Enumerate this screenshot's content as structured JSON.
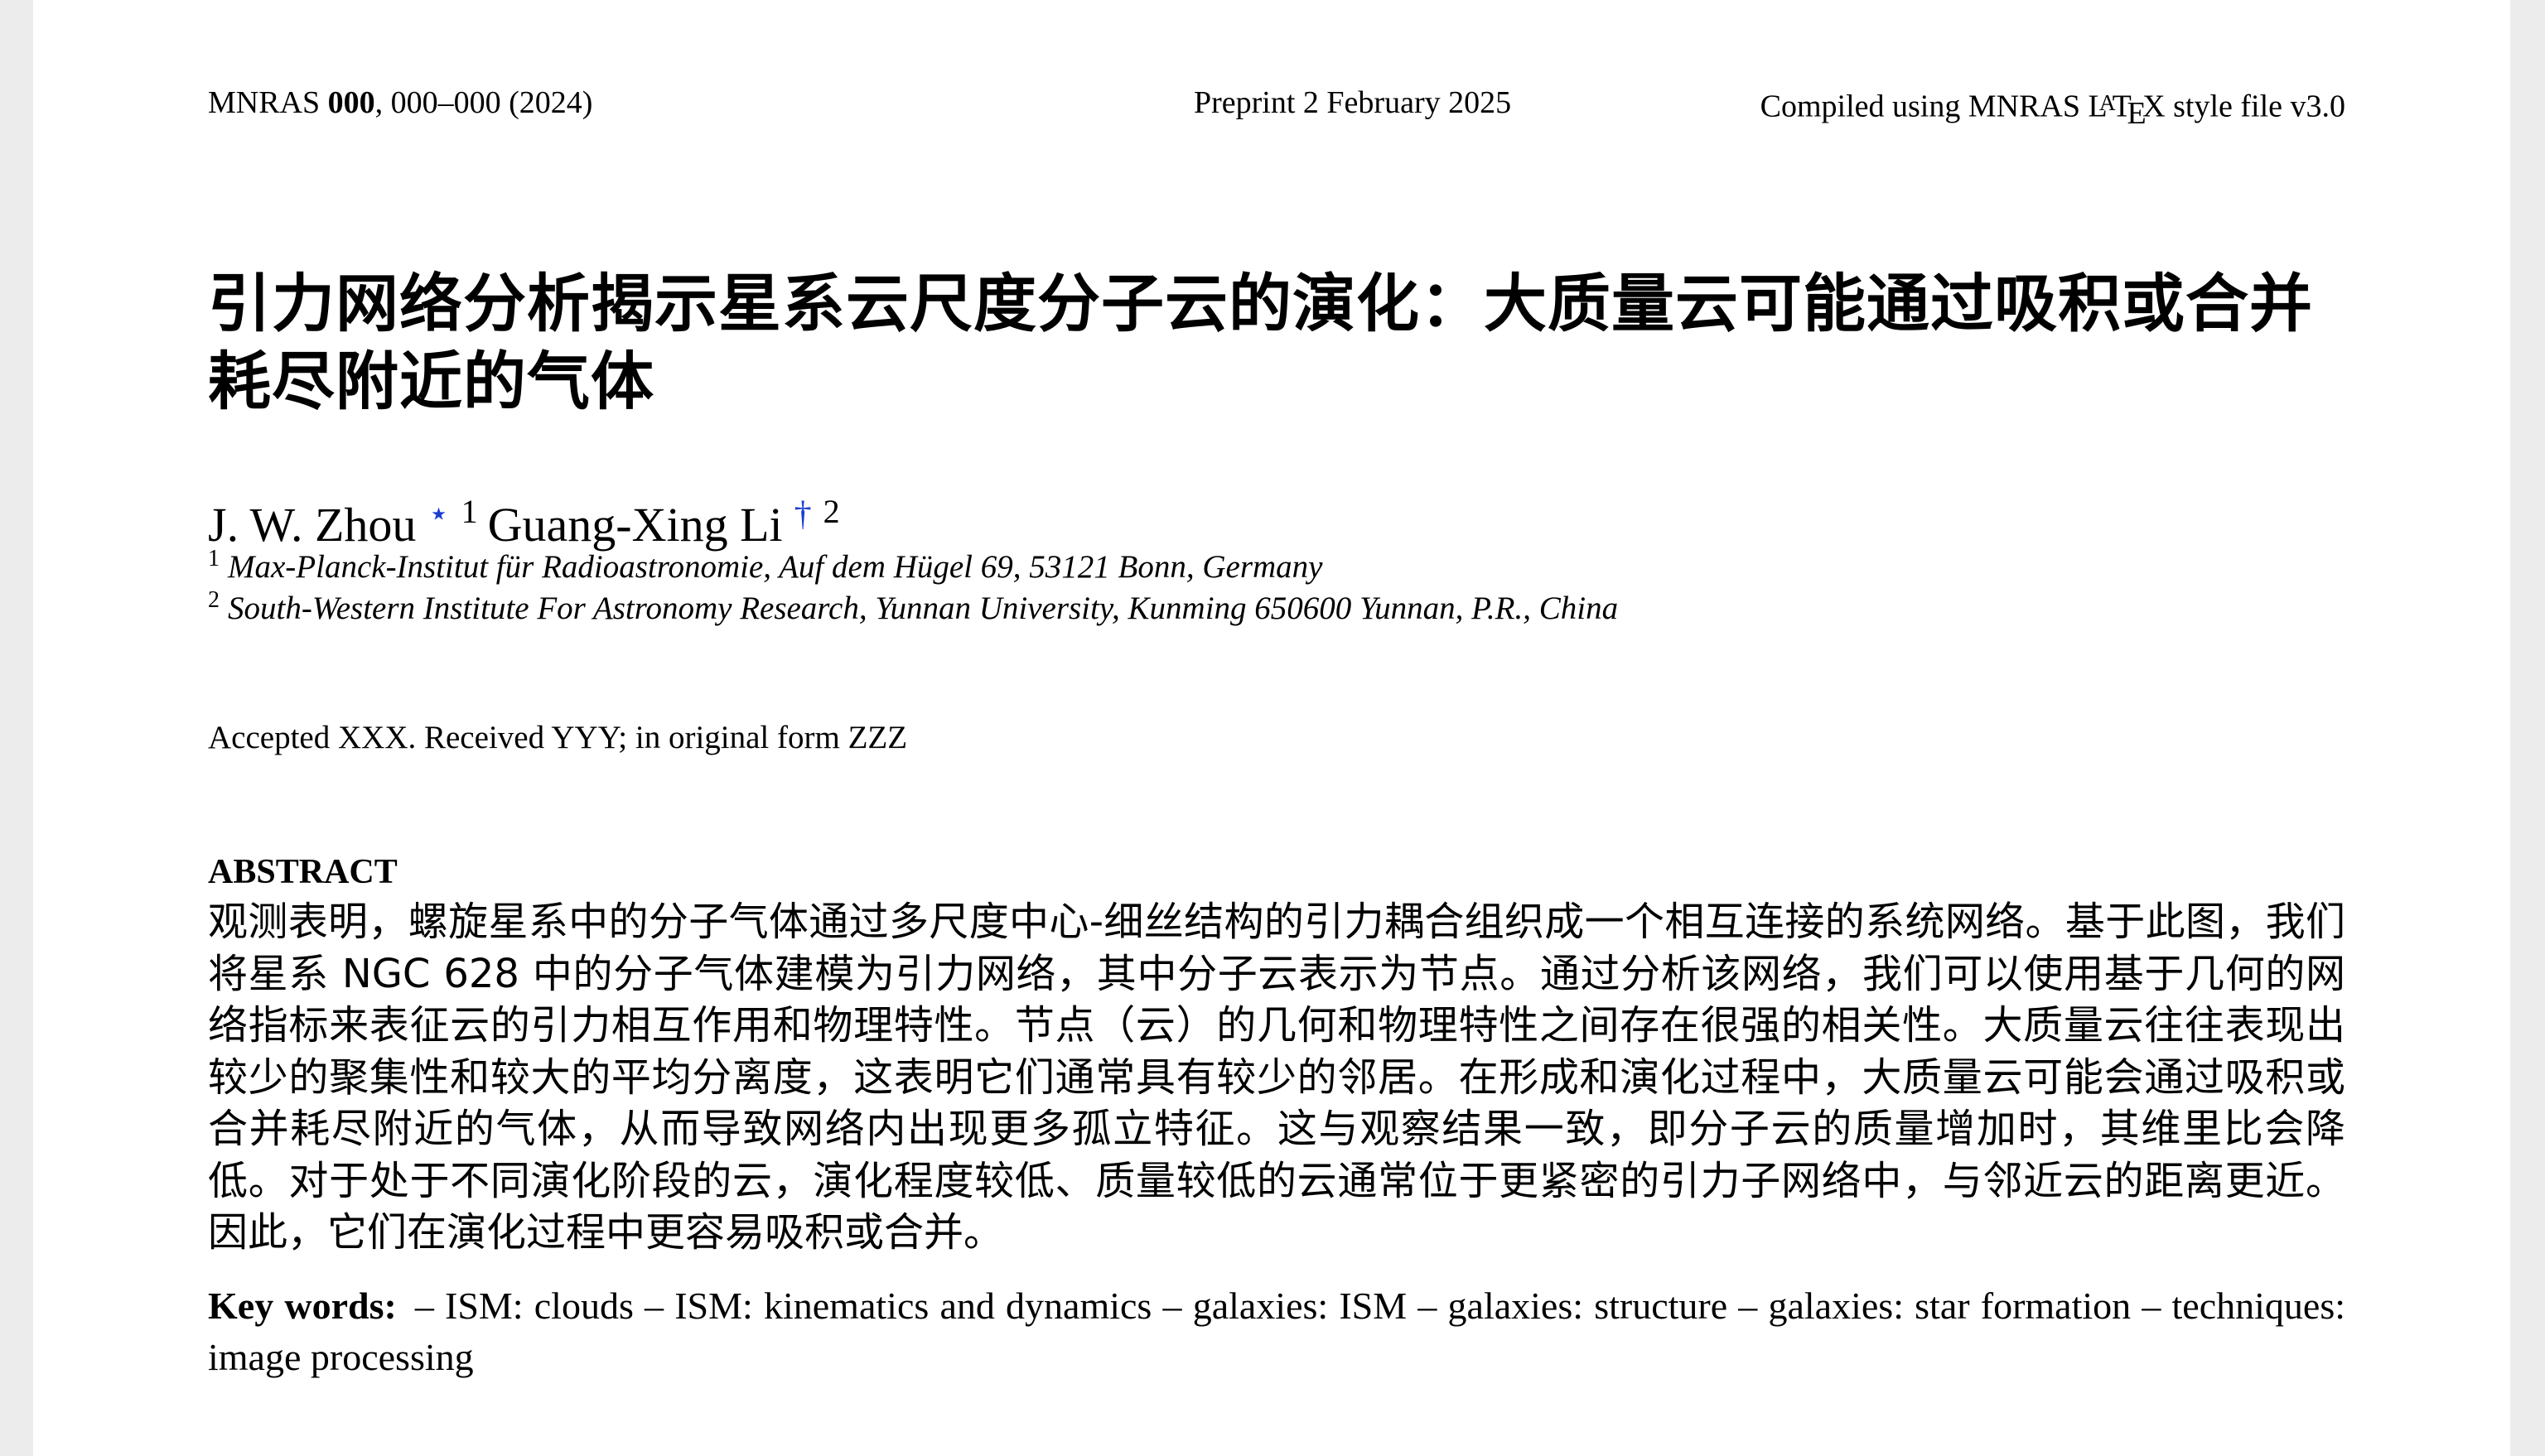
{
  "header": {
    "journal_prefix": "MNRAS ",
    "journal_volume": "000",
    "journal_suffix": ", 000–000 (2024)",
    "preprint": "Preprint 2 February 2025",
    "compiled_prefix": "Compiled using MNRAS ",
    "latex_L": "L",
    "latex_A": "A",
    "latex_T": "T",
    "latex_E": "E",
    "latex_X": "X",
    "compiled_suffix": " style file v3.0"
  },
  "title": "引力网络分析揭示星系云尺度分子云的演化：大质量云可能通过吸积或合并耗尽附近的气体",
  "authors": [
    {
      "name": "J. W. Zhou",
      "symbol": "⋆",
      "affiliation_number": "1"
    },
    {
      "name": "Guang-Xing Li",
      "symbol": "†",
      "affiliation_number": "2"
    }
  ],
  "affiliations": [
    {
      "number": "1",
      "text": "Max-Planck-Institut für Radioastronomie, Auf dem Hügel 69, 53121 Bonn, Germany"
    },
    {
      "number": "2",
      "text": "South-Western Institute For Astronomy Research, Yunnan University, Kunming 650600 Yunnan, P.R., China"
    }
  ],
  "accepted_line": "Accepted XXX. Received YYY; in original form ZZZ",
  "abstract": {
    "heading": "ABSTRACT",
    "text": "观测表明，螺旋星系中的分子气体通过多尺度中心-细丝结构的引力耦合组织成一个相互连接的系统网络。基于此图，我们将星系 NGC 628 中的分子气体建模为引力网络，其中分子云表示为节点。通过分析该网络，我们可以使用基于几何的网络指标来表征云的引力相互作用和物理特性。节点（云）的几何和物理特性之间存在很强的相关性。大质量云往往表现出较少的聚集性和较大的平均分离度，这表明它们通常具有较少的邻居。在形成和演化过程中，大质量云可能会通过吸积或合并耗尽附近的气体，从而导致网络内出现更多孤立特征。这与观察结果一致，即分子云的质量增加时，其维里比会降低。对于处于不同演化阶段的云，演化程度较低、质量较低的云通常位于更紧密的引力子网络中，与邻近云的距离更近。因此，它们在演化过程中更容易吸积或合并。"
  },
  "keywords": {
    "label": "Key words:",
    "text": "– ISM: clouds – ISM: kinematics and dynamics – galaxies: ISM – galaxies: structure – galaxies: star formation – techniques: image processing"
  }
}
